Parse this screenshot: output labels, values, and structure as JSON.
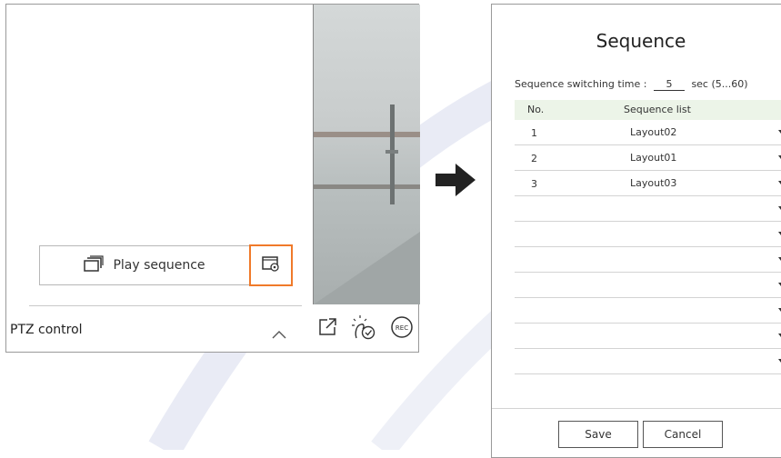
{
  "left_panel": {
    "play_sequence_label": "Play sequence",
    "ptz_label": "PTZ control",
    "rec_label": "REC"
  },
  "dialog": {
    "title": "Sequence",
    "switching_label": "Sequence switching time :",
    "switching_value": "5",
    "switching_unit": "sec (5...60)",
    "col_no": "No.",
    "col_list": "Sequence list",
    "rows": [
      {
        "no": "1",
        "name": "Layout02"
      },
      {
        "no": "2",
        "name": "Layout01"
      },
      {
        "no": "3",
        "name": "Layout03"
      },
      {
        "no": "",
        "name": ""
      },
      {
        "no": "",
        "name": ""
      },
      {
        "no": "",
        "name": ""
      },
      {
        "no": "",
        "name": ""
      },
      {
        "no": "",
        "name": ""
      },
      {
        "no": "",
        "name": ""
      },
      {
        "no": "",
        "name": ""
      }
    ],
    "save_label": "Save",
    "cancel_label": "Cancel"
  },
  "colors": {
    "highlight": "#f07a2a",
    "header_bg": "#ecf4e8"
  }
}
